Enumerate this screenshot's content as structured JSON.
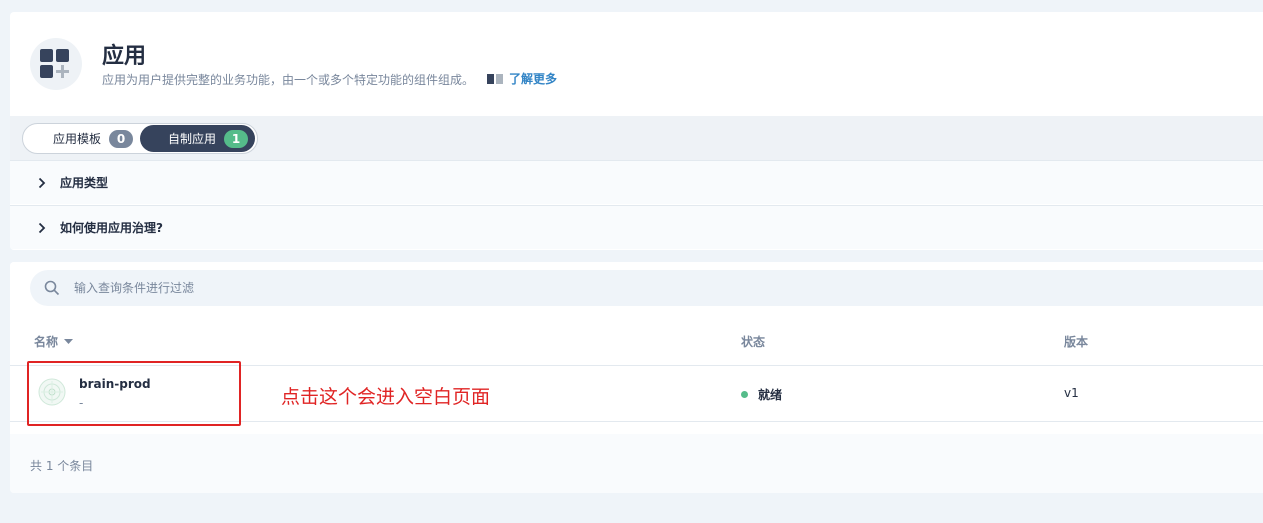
{
  "header": {
    "title": "应用",
    "description": "应用为用户提供完整的业务功能，由一个或多个特定功能的组件组成。",
    "learn_more": "了解更多",
    "logo_icon": "apps-grid-icon"
  },
  "tabs": [
    {
      "label": "应用模板",
      "count": "0",
      "active": false
    },
    {
      "label": "自制应用",
      "count": "1",
      "active": true
    }
  ],
  "collapsibles": [
    {
      "label": "应用类型"
    },
    {
      "label": "如何使用应用治理?"
    }
  ],
  "search": {
    "placeholder": "输入查询条件进行过滤"
  },
  "table": {
    "columns": {
      "name": "名称",
      "status": "状态",
      "version": "版本"
    },
    "rows": [
      {
        "name": "brain-prod",
        "description": "-",
        "status": "就绪",
        "status_color": "#55bc8a",
        "version": "v1"
      }
    ]
  },
  "footer": {
    "total": "共 1 个条目"
  },
  "annotation": {
    "text": "点击这个会进入空白页面",
    "color": "#e02424"
  },
  "colors": {
    "accent": "#3385c6",
    "dark": "#36435c",
    "success": "#55bc8a"
  }
}
